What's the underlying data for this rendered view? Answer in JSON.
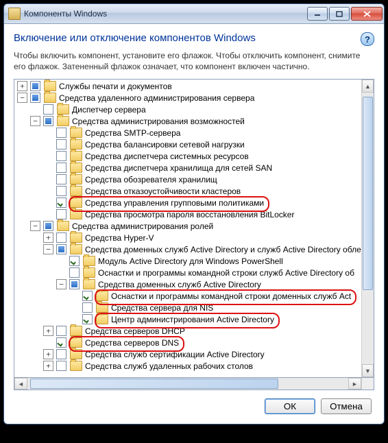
{
  "window": {
    "title": "Компоненты Windows"
  },
  "heading": "Включение или отключение компонентов Windows",
  "description": "Чтобы включить компонент, установите его флажок. Чтобы отключить компонент, снимите его флажок. Затененный флажок означает, что компонент включен частично.",
  "help_tooltip": "?",
  "buttons": {
    "ok": "ОК",
    "cancel": "Отмена"
  },
  "twist": {
    "plus": "+",
    "minus": "−"
  },
  "tree": [
    {
      "indent": 0,
      "twist": "plus",
      "check": "partial",
      "label": "Службы печати и документов"
    },
    {
      "indent": 0,
      "twist": "minus",
      "check": "partial",
      "label": "Средства удаленного администрирования сервера"
    },
    {
      "indent": 1,
      "twist": null,
      "check": "none",
      "label": "Диспетчер сервера"
    },
    {
      "indent": 1,
      "twist": "minus",
      "check": "partial",
      "label": "Средства администрирования возможностей"
    },
    {
      "indent": 2,
      "twist": null,
      "check": "none",
      "label": "Средства SMTP-сервера"
    },
    {
      "indent": 2,
      "twist": null,
      "check": "none",
      "label": "Средства балансировки сетевой нагрузки"
    },
    {
      "indent": 2,
      "twist": null,
      "check": "none",
      "label": "Средства диспетчера системных ресурсов"
    },
    {
      "indent": 2,
      "twist": null,
      "check": "none",
      "label": "Средства диспетчера хранилища для сетей SAN"
    },
    {
      "indent": 2,
      "twist": null,
      "check": "none",
      "label": "Средства обозревателя хранилищ"
    },
    {
      "indent": 2,
      "twist": null,
      "check": "none",
      "label": "Средства отказоустойчивости кластеров"
    },
    {
      "indent": 2,
      "twist": null,
      "check": "checked",
      "label": "Средства управления групповыми политиками",
      "hl": true
    },
    {
      "indent": 2,
      "twist": null,
      "check": "none",
      "label": "Средства просмотра пароля восстановления BitLocker"
    },
    {
      "indent": 1,
      "twist": "minus",
      "check": "partial",
      "label": "Средства администрирования ролей"
    },
    {
      "indent": 2,
      "twist": "plus",
      "check": "none",
      "label": "Средства Hyper-V"
    },
    {
      "indent": 2,
      "twist": "minus",
      "check": "partial",
      "label": "Средства доменных служб Active Directory и служб Active Directory обле"
    },
    {
      "indent": 3,
      "twist": null,
      "check": "checked",
      "label": "Модуль Active Directory для Windows PowerShell"
    },
    {
      "indent": 3,
      "twist": null,
      "check": "none",
      "label": "Оснастки и программы командной строки служб Active Directory об"
    },
    {
      "indent": 3,
      "twist": "minus",
      "check": "partial",
      "label": "Средства доменных служб Active Directory"
    },
    {
      "indent": 4,
      "twist": null,
      "check": "checked",
      "label": "Оснастки и программы командной строки доменных служб Act",
      "hl": true
    },
    {
      "indent": 4,
      "twist": null,
      "check": "none",
      "label": "Средства сервера для NIS"
    },
    {
      "indent": 4,
      "twist": null,
      "check": "checked",
      "label": "Центр администрирования Active Directory",
      "hl": true
    },
    {
      "indent": 2,
      "twist": "plus",
      "check": "none",
      "label": "Средства серверов DHCP"
    },
    {
      "indent": 2,
      "twist": null,
      "check": "checked",
      "label": "Средства серверов DNS",
      "hl": true
    },
    {
      "indent": 2,
      "twist": "plus",
      "check": "none",
      "label": "Средства служб сертификации Active Directory"
    },
    {
      "indent": 2,
      "twist": "plus",
      "check": "none",
      "label": "Средства служб удаленных рабочих столов"
    }
  ]
}
